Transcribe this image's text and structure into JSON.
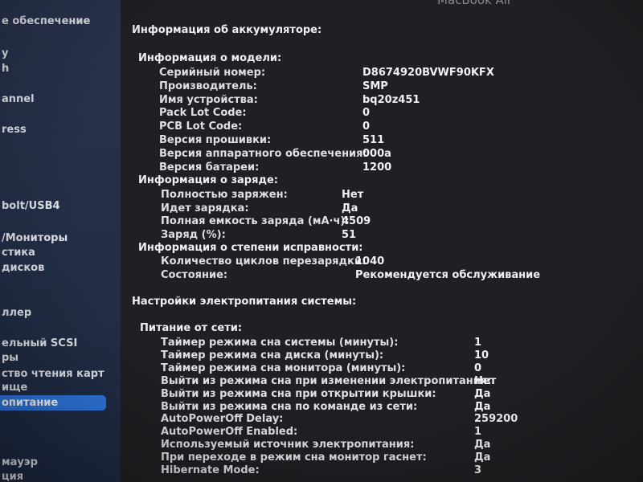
{
  "window": {
    "title": "MacBook Air"
  },
  "sidebar": {
    "items": [
      {
        "label": "е обеспечение"
      },
      {
        "label": "y"
      },
      {
        "label": "h"
      },
      {
        "label": "annel"
      },
      {
        "label": "ress"
      },
      {
        "label": "bolt/USB4"
      },
      {
        "label": "/Мониторы"
      },
      {
        "label": "стика"
      },
      {
        "label": "дисков"
      },
      {
        "label": "ллер"
      },
      {
        "label": "ельный SCSI"
      },
      {
        "label": "ры"
      },
      {
        "label": "ство чтения карт"
      },
      {
        "label": "ище"
      },
      {
        "label": "опитание"
      },
      {
        "label": "мауэр"
      },
      {
        "label": "ция"
      }
    ],
    "selected_label": "опитание"
  },
  "battery": {
    "title": "Информация об аккумуляторе:",
    "model": {
      "heading": "Информация о модели:",
      "rows": [
        {
          "label": "Серийный номер:",
          "value": "D8674920BVWF90KFX"
        },
        {
          "label": "Производитель:",
          "value": "SMP"
        },
        {
          "label": "Имя устройства:",
          "value": "bq20z451"
        },
        {
          "label": "Pack Lot Code:",
          "value": "0"
        },
        {
          "label": "PCB Lot Code:",
          "value": "0"
        },
        {
          "label": "Версия прошивки:",
          "value": "511"
        },
        {
          "label": "Версия аппаратного обеспечения:",
          "value": "000a"
        },
        {
          "label": "Версия батареи:",
          "value": "1200"
        }
      ]
    },
    "charge": {
      "heading": "Информация о заряде:",
      "rows": [
        {
          "label": "Полностью заряжен:",
          "value": "Нет"
        },
        {
          "label": "Идет зарядка:",
          "value": "Да"
        },
        {
          "label": "Полная емкость заряда (мА·ч):",
          "value": "4509"
        },
        {
          "label": "Заряд (%):",
          "value": "51"
        }
      ]
    },
    "health": {
      "heading": "Информация о степени исправности:",
      "rows": [
        {
          "label": "Количество циклов перезарядки:",
          "value": "1040"
        },
        {
          "label": "Состояние:",
          "value": "Рекомендуется обслуживание"
        }
      ]
    }
  },
  "power": {
    "title": "Настройки электропитания системы:",
    "ac": {
      "heading": "Питание от сети:",
      "rows": [
        {
          "label": "Таймер режима сна системы (минуты):",
          "value": "1"
        },
        {
          "label": "Таймер режима сна диска (минуты):",
          "value": "10"
        },
        {
          "label": "Таймер режима сна монитора (минуты):",
          "value": "0"
        },
        {
          "label": "Выйти из режима сна при изменении электропитания:",
          "value": "Нет"
        },
        {
          "label": "Выйти из режима сна при открытии крышки:",
          "value": "Да"
        },
        {
          "label": "Выйти из режима сна по команде из сети:",
          "value": "Да"
        },
        {
          "label": "AutoPowerOff Delay:",
          "value": "259200"
        },
        {
          "label": "AutoPowerOff Enabled:",
          "value": "1"
        },
        {
          "label": "Используемый источник электропитания:",
          "value": "Да"
        },
        {
          "label": "При переходе в режим сна монитор гаснет:",
          "value": "Да"
        },
        {
          "label": "Hibernate Mode:",
          "value": "3"
        }
      ]
    }
  }
}
